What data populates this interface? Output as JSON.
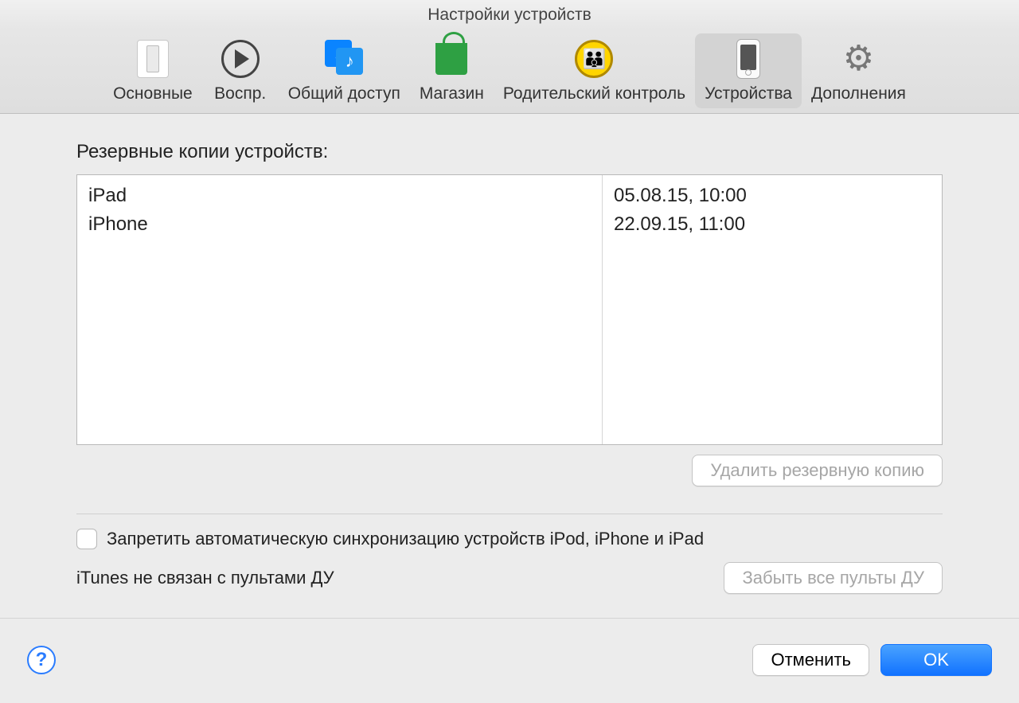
{
  "window": {
    "title": "Настройки устройств"
  },
  "toolbar": {
    "items": [
      {
        "label": "Основные"
      },
      {
        "label": "Воспр."
      },
      {
        "label": "Общий доступ"
      },
      {
        "label": "Магазин"
      },
      {
        "label": "Родительский контроль"
      },
      {
        "label": "Устройства"
      },
      {
        "label": "Дополнения"
      }
    ],
    "active_index": 5
  },
  "backups": {
    "section_label": "Резервные копии устройств:",
    "rows": [
      {
        "name": "iPad",
        "date": "05.08.15, 10:00"
      },
      {
        "name": "iPhone",
        "date": "22.09.15, 11:00"
      }
    ],
    "delete_button": "Удалить резервную копию"
  },
  "options": {
    "prevent_sync_label": "Запретить автоматическую синхронизацию устройств iPod, iPhone и iPad",
    "prevent_sync_checked": false,
    "remote_status": "iTunes не связан с пультами ДУ",
    "forget_remotes_button": "Забыть все пульты ДУ"
  },
  "footer": {
    "help": "?",
    "cancel": "Отменить",
    "ok": "OK"
  }
}
